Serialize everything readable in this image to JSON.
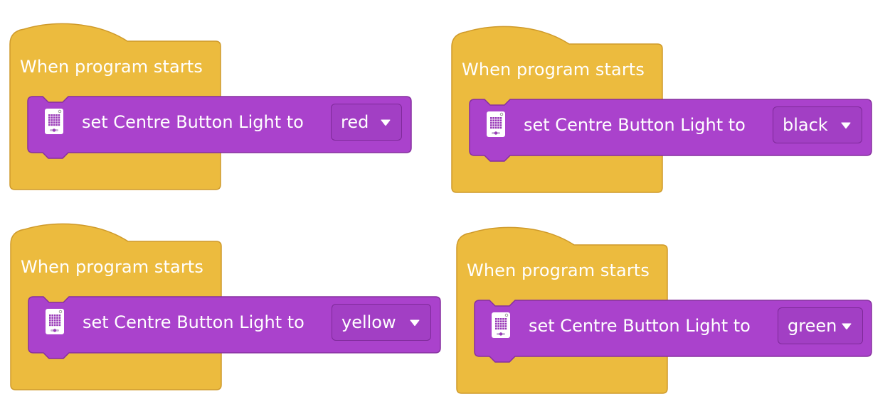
{
  "colors": {
    "event_block": "#ecbb3e",
    "event_border": "#cf9a2a",
    "command_block": "#aa42cc",
    "command_border": "#86309f",
    "dropdown_bg": "#a23fc4",
    "text": "#ffffff"
  },
  "blocks": [
    {
      "hat_label": "When program starts",
      "command_label": "set Centre Button Light to",
      "icon": "hub-matrix-icon",
      "dropdown_value": "red",
      "dropdown_arrow_icon": "caret-down-icon"
    },
    {
      "hat_label": "When program starts",
      "command_label": "set Centre Button Light to",
      "icon": "hub-matrix-icon",
      "dropdown_value": "black",
      "dropdown_arrow_icon": "caret-down-icon"
    },
    {
      "hat_label": "When program starts",
      "command_label": "set Centre Button Light to",
      "icon": "hub-matrix-icon",
      "dropdown_value": "yellow",
      "dropdown_arrow_icon": "caret-down-icon"
    },
    {
      "hat_label": "When program starts",
      "command_label": "set Centre Button Light to",
      "icon": "hub-matrix-icon",
      "dropdown_value": "green",
      "dropdown_arrow_icon": "caret-down-icon"
    }
  ]
}
